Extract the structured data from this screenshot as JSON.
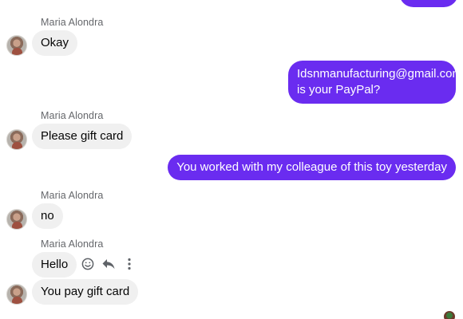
{
  "contact": {
    "name": "Maria Alondra"
  },
  "messages": [
    {
      "id": "m1",
      "dir": "in",
      "sender": "Maria Alondra",
      "text": "Okay"
    },
    {
      "id": "m2",
      "dir": "out",
      "line1": "Idsnmanufacturing@gmail.com",
      "line2": "is your PayPal?"
    },
    {
      "id": "m3",
      "dir": "in",
      "sender": "Maria Alondra",
      "text": "Please gift card"
    },
    {
      "id": "m4",
      "dir": "out",
      "text": "You worked with my colleague of this toy yesterday"
    },
    {
      "id": "m5",
      "dir": "in",
      "sender": "Maria Alondra",
      "text": "no"
    },
    {
      "id": "m6",
      "dir": "in",
      "sender": "Maria Alondra",
      "text": "Hello"
    },
    {
      "id": "m7",
      "dir": "in",
      "text": "You pay gift card"
    }
  ],
  "hover_actions": {
    "icons": [
      "emoji-icon",
      "reply-icon",
      "more-icon"
    ]
  },
  "colors": {
    "outgoing": "#6a2cf0",
    "incoming": "#f0f0f0",
    "sender_label": "#65676b"
  }
}
